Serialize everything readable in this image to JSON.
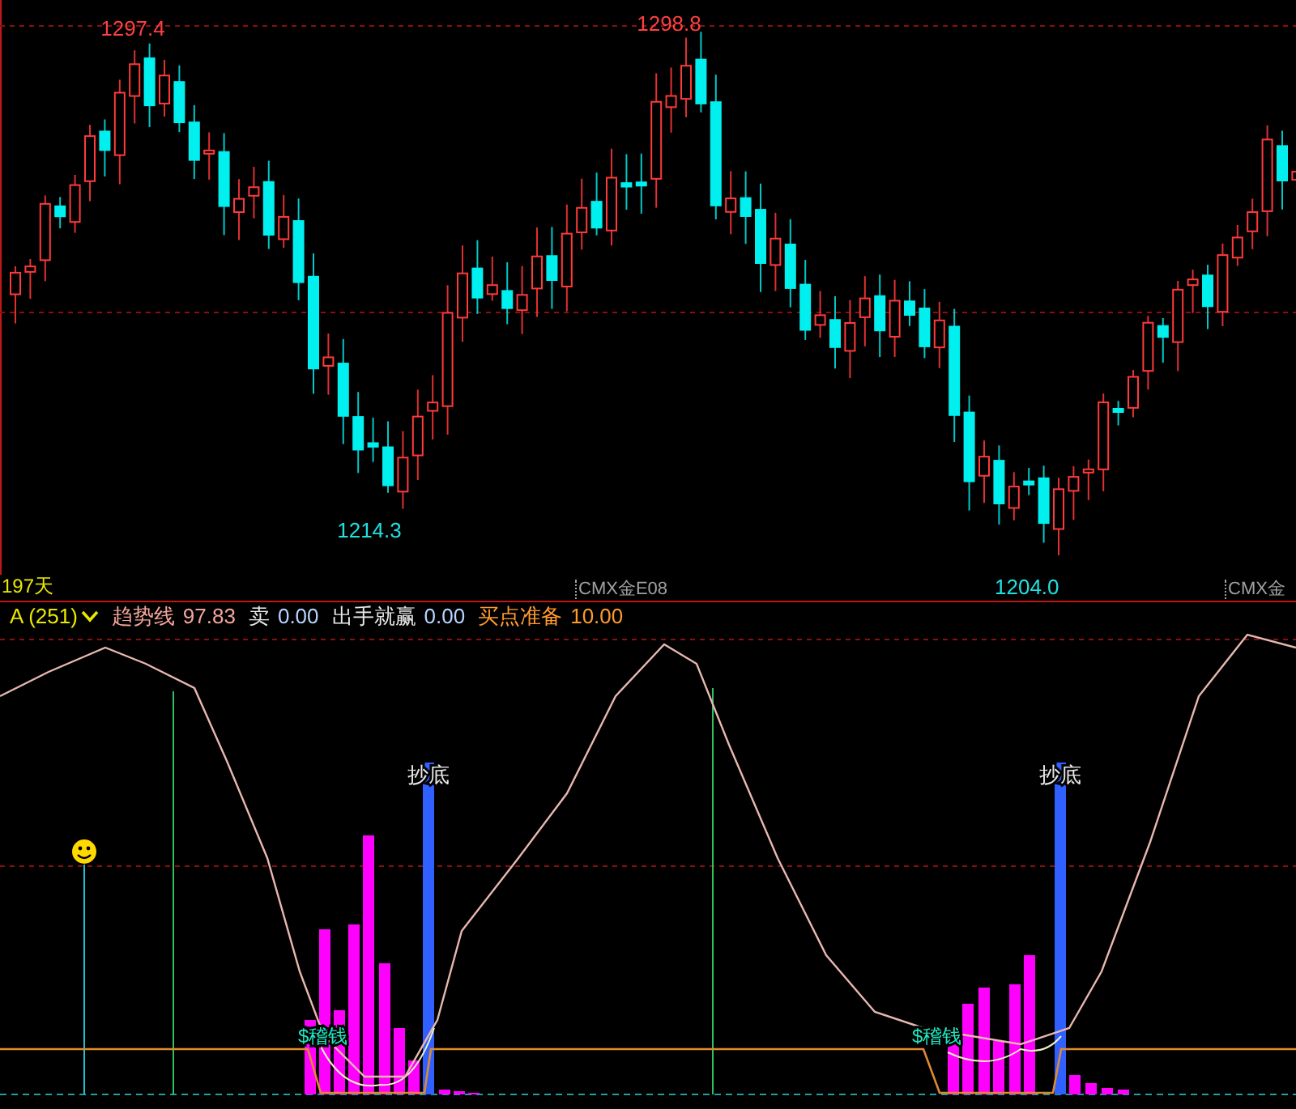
{
  "price_chart": {
    "extreme_labels": [
      {
        "text": "1297.4",
        "kind": "high"
      },
      {
        "text": "1298.8",
        "kind": "high"
      },
      {
        "text": "1214.3",
        "kind": "low"
      },
      {
        "text": "1204.0",
        "kind": "low"
      }
    ]
  },
  "time_axis": {
    "period": "197天",
    "contract_labels": [
      "CMX金E08",
      "CMX金"
    ]
  },
  "indicator": {
    "name": "A (251)",
    "values": [
      {
        "label": "趋势线",
        "value": "97.83",
        "color": "#f4a69a"
      },
      {
        "label": "卖",
        "value": "0.00",
        "color": "#e8e8e8"
      },
      {
        "label": "出手就赢",
        "value": "0.00",
        "color": "#e8e8e8"
      },
      {
        "label": "买点准备",
        "value": "10.00",
        "color": "#ff9a2e"
      }
    ]
  },
  "signals": [
    {
      "label": "抄底"
    },
    {
      "label": "抄底"
    }
  ],
  "markers": [
    "$稽钱",
    "$稽钱"
  ]
}
